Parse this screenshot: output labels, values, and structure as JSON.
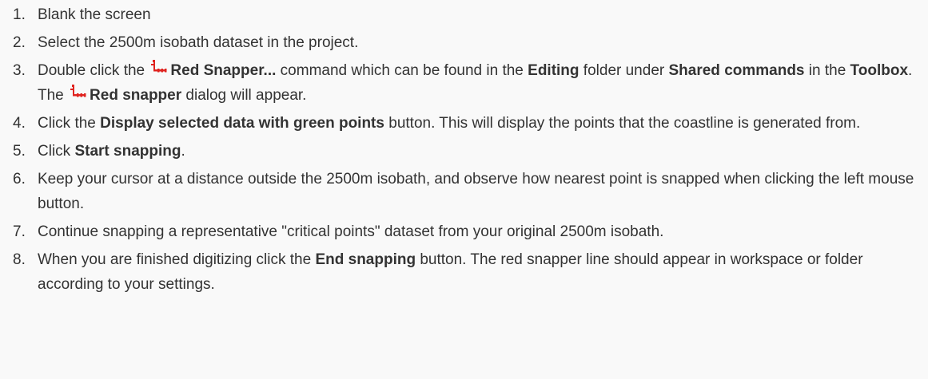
{
  "steps": [
    {
      "number": "1.",
      "text": "Blank the screen"
    },
    {
      "number": "2.",
      "text": "Select the 2500m isobath dataset in the project."
    },
    {
      "number": "3.",
      "t1": "Double click the ",
      "b1": "Red Snapper...",
      "t2": " command which can be found in the ",
      "b2": "Editing",
      "t3": " folder under ",
      "b3": "Shared commands",
      "t4": " in the ",
      "b4": "Toolbox",
      "t5": ". The ",
      "b5": "Red snapper",
      "t6": " dialog will appear."
    },
    {
      "number": "4.",
      "t1": "Click the ",
      "b1": "Display selected data with green points",
      "t2": " button. This will display the points that the coastline is generated from."
    },
    {
      "number": "5.",
      "t1": "Click ",
      "b1": "Start snapping",
      "t2": "."
    },
    {
      "number": "6.",
      "text": "Keep your cursor at a distance outside the 2500m isobath, and observe how nearest point is snapped when clicking the left mouse button."
    },
    {
      "number": "7.",
      "text": "Continue snapping a representative \"critical points\" dataset from your original 2500m isobath."
    },
    {
      "number": "8.",
      "t1": "When you are finished digitizing click the ",
      "b1": "End snapping",
      "t2": " button. The red snapper line should appear in workspace or folder according to your settings."
    }
  ],
  "icons": {
    "red_snapper": "red-snapper-icon",
    "color": "#e0231f"
  }
}
